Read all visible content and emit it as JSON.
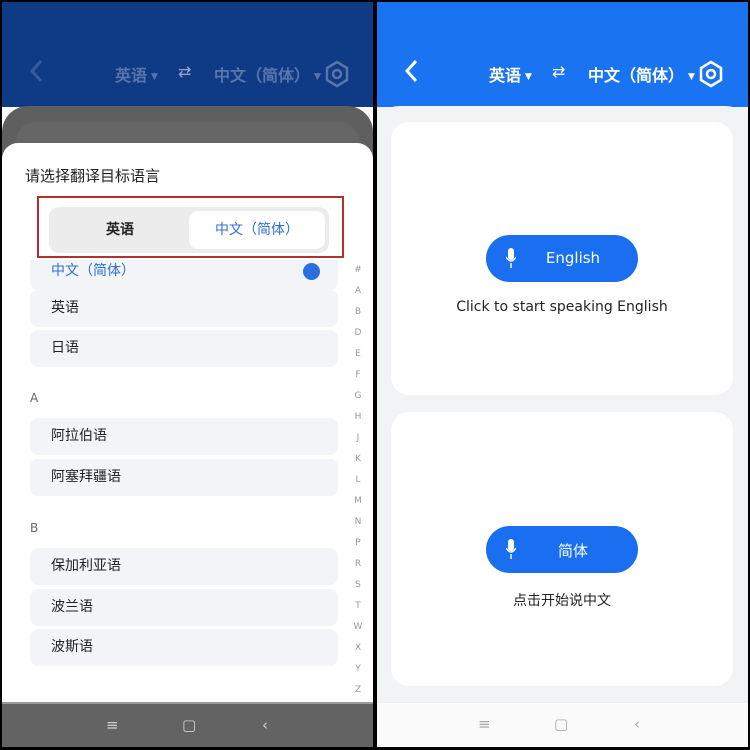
{
  "left": {
    "header": {
      "source_lang": "英语",
      "target_lang": "中文（简体）"
    },
    "sheet": {
      "title": "请选择翻译目标语言",
      "segmented": {
        "options": [
          "英语",
          "中文（简体）"
        ],
        "selected": "中文（简体）"
      },
      "pinned": [
        {
          "label": "中文（简体）",
          "selected": true
        },
        {
          "label": "英语"
        },
        {
          "label": "日语"
        }
      ],
      "sections": [
        {
          "letter": "A",
          "items": [
            "阿拉伯语",
            "阿塞拜疆语"
          ]
        },
        {
          "letter": "B",
          "items": [
            "保加利亚语",
            "波兰语",
            "波斯语"
          ]
        }
      ],
      "index": [
        "#",
        "A",
        "B",
        "D",
        "E",
        "F",
        "G",
        "H",
        "J",
        "K",
        "L",
        "M",
        "N",
        "P",
        "R",
        "S",
        "T",
        "W",
        "X",
        "Y",
        "Z"
      ]
    }
  },
  "right": {
    "header": {
      "source_lang": "英语",
      "target_lang": "中文（简体）"
    },
    "cards": [
      {
        "button": "English",
        "hint": "Click to start speaking English"
      },
      {
        "button": "简体",
        "hint": "点击开始说中文"
      }
    ]
  },
  "nav": {
    "menu": "≡",
    "home": "▢",
    "back": "‹"
  },
  "colors": {
    "brand_blue": "#1a74f2",
    "highlight_red": "#b3312c",
    "selected_text": "#2a6fdb"
  }
}
